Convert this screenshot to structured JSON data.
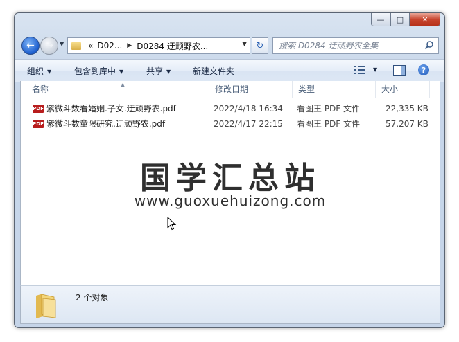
{
  "window": {
    "caption": {
      "minimize": "—",
      "maximize": "□",
      "close": "✕"
    }
  },
  "nav": {
    "back_icon": "back-arrow-icon",
    "forward_icon": "forward-arrow-icon",
    "breadcrumb": {
      "overflow": "«",
      "parent": "D02...",
      "current": "D0284 迂顽野农..."
    },
    "refresh_glyph": "↻",
    "search_placeholder": "搜索 D0284 迂顽野农全集"
  },
  "toolbar": {
    "organize": "组织",
    "include_in_library": "包含到库中",
    "share": "共享",
    "new_folder": "新建文件夹",
    "help": "?"
  },
  "columns": {
    "name": "名称",
    "date_modified": "修改日期",
    "type": "类型",
    "size": "大小"
  },
  "files": [
    {
      "icon": "PDF",
      "name": "紫微斗数看婚姻.子女.迂顽野农.pdf",
      "date": "2022/4/18 16:34",
      "type": "看图王 PDF 文件",
      "size": "22,335 KB"
    },
    {
      "icon": "PDF",
      "name": "紫微斗数童限研究.迂顽野农.pdf",
      "date": "2022/4/17 22:15",
      "type": "看图王 PDF 文件",
      "size": "57,207 KB"
    }
  ],
  "watermark": {
    "title": "国学汇总站",
    "url": "www.guoxuehuizong.com"
  },
  "details": {
    "item_count": "2 个对象"
  },
  "colors": {
    "frame": "#c8d7ea",
    "toolbar_text": "#1b2a45",
    "close_button": "#c8452e",
    "pdf_icon": "#b81d1d"
  }
}
